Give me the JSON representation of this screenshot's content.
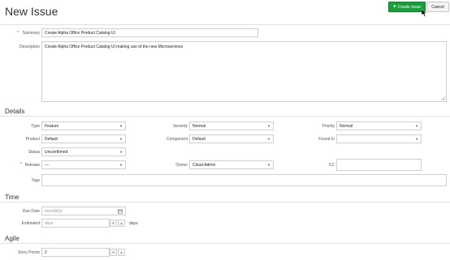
{
  "page_title": "New Issue",
  "actions": {
    "create_label": "Create Issue",
    "cancel_label": "Cancel"
  },
  "summary": {
    "label": "Summary",
    "value": "Create Alpha Office Product Catalog UI"
  },
  "description": {
    "label": "Description",
    "value": "Create Alpha Office Product Catalog UI making use of the new Microservices"
  },
  "details": {
    "heading": "Details",
    "type": {
      "label": "Type",
      "value": "Feature"
    },
    "severity": {
      "label": "Severity",
      "value": "Normal"
    },
    "priority": {
      "label": "Priority",
      "value": "Normal"
    },
    "product": {
      "label": "Product",
      "value": "Default"
    },
    "component": {
      "label": "Component",
      "value": "Default"
    },
    "found_in": {
      "label": "Found In",
      "value": ""
    },
    "status": {
      "label": "Status",
      "value": "Unconfirmed"
    },
    "release": {
      "label": "Release",
      "value": "---"
    },
    "owner": {
      "label": "Owner",
      "value": "Cloud Admin"
    },
    "cc": {
      "label": "CC",
      "value": ""
    },
    "tags": {
      "label": "Tags",
      "value": ""
    }
  },
  "time": {
    "heading": "Time",
    "due_date": {
      "label": "Due Date",
      "placeholder": "mm/dd/yy"
    },
    "estimated": {
      "label": "Estimated",
      "placeholder": "days",
      "unit": "days"
    }
  },
  "agile": {
    "heading": "Agile",
    "story_points": {
      "label": "Story Points",
      "value": "2"
    }
  },
  "icons": {
    "plus": "+",
    "caret": "▼",
    "up": "▲",
    "down": "▼"
  },
  "colors": {
    "primary": "#1f9a3c",
    "required": "#2b6fd1"
  }
}
